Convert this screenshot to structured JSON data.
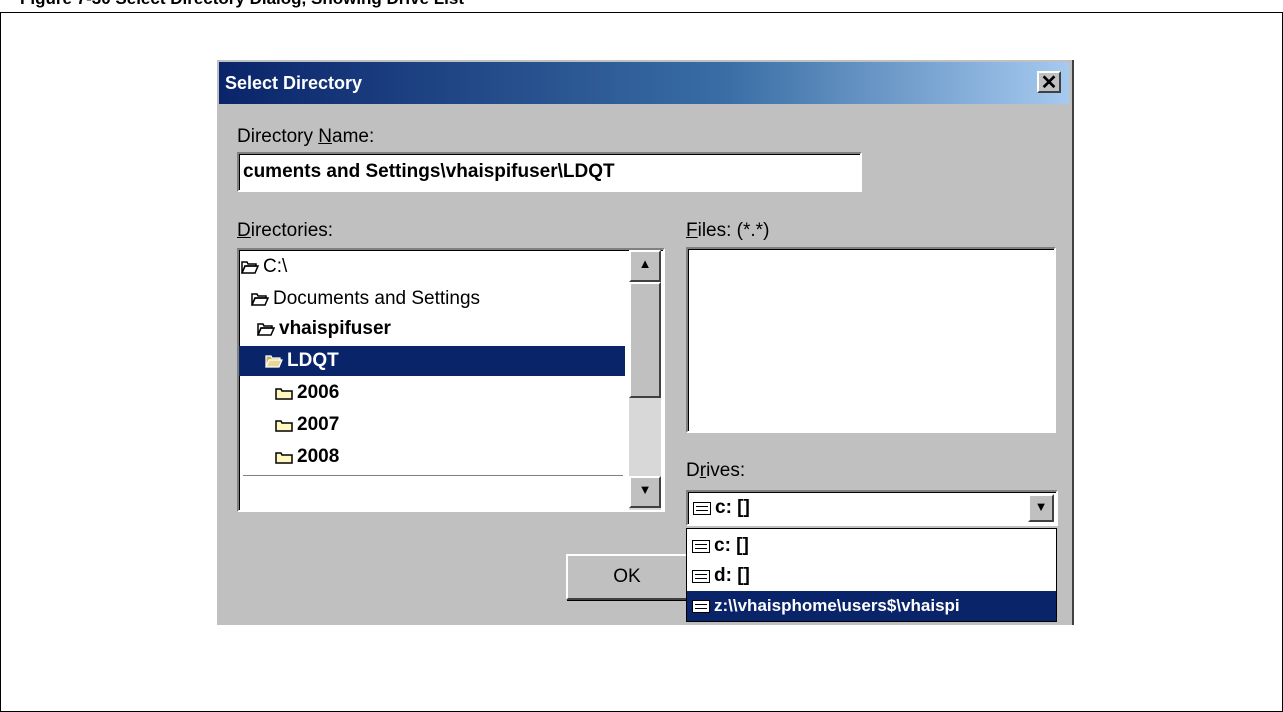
{
  "caption": "Figure 7-30 Select Directory Dialog, Showing Drive List",
  "dialog": {
    "title": "Select Directory",
    "close_glyph": "✕",
    "directory_name_label_pre": "Directory ",
    "directory_name_label_ul": "N",
    "directory_name_label_post": "ame:",
    "directory_name_value": "cuments and Settings\\vhaispifuser\\LDQT",
    "directories_label_ul": "D",
    "directories_label_post": "irectories:",
    "directories": [
      {
        "label": "C:\\",
        "icon": "open-folder-icon"
      },
      {
        "label": "Documents and Settings",
        "icon": "open-folder-icon"
      },
      {
        "label": "vhaispifuser",
        "icon": "open-folder-icon"
      },
      {
        "label": "LDQT",
        "icon": "open-folder-icon"
      },
      {
        "label": "2006",
        "icon": "folder-icon"
      },
      {
        "label": "2007",
        "icon": "folder-icon"
      },
      {
        "label": "2008",
        "icon": "folder-icon"
      }
    ],
    "files_label_ul": "F",
    "files_label_post": "iles: (*.*)",
    "drives_label_pre": "D",
    "drives_label_ul": "r",
    "drives_label_post": "ives:",
    "drives_selected": "c: []",
    "drive_options": [
      {
        "label": "c: []",
        "icon": "hard-drive-icon"
      },
      {
        "label": "d: []",
        "icon": "cd-drive-icon"
      },
      {
        "label": "z:\\\\vhaisphome\\users$\\vhaispi",
        "icon": "network-drive-icon"
      }
    ],
    "ok_label": "OK",
    "scroll_up_glyph": "▲",
    "scroll_down_glyph": "▼",
    "combo_arrow_glyph": "▼"
  },
  "colors": {
    "titlebar_start": "#0a246a",
    "titlebar_end": "#a6caf0",
    "dialog_face": "#c0c0c0",
    "selection": "#0a246a"
  }
}
